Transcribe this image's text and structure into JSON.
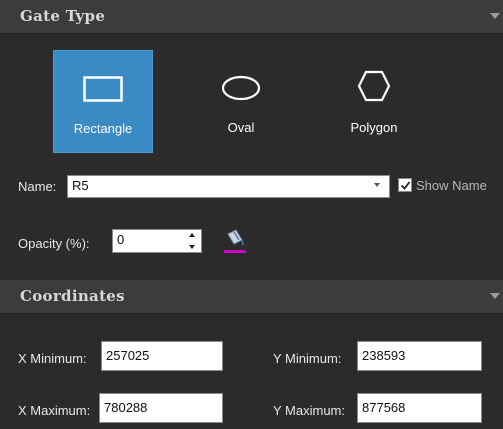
{
  "gate_type": {
    "title": "Gate Type",
    "options": [
      {
        "label": "Rectangle",
        "icon": "rectangle-icon",
        "selected": true
      },
      {
        "label": "Oval",
        "icon": "oval-icon",
        "selected": false
      },
      {
        "label": "Polygon",
        "icon": "hexagon-icon",
        "selected": false
      }
    ]
  },
  "name": {
    "label": "Name:",
    "value": "R5"
  },
  "show_name": {
    "label": "Show Name",
    "checked": true
  },
  "opacity": {
    "label": "Opacity (%):",
    "value": "0"
  },
  "coordinates": {
    "title": "Coordinates",
    "x_min_label": "X Minimum:",
    "x_min": "257025",
    "y_min_label": "Y Minimum:",
    "y_min": "238593",
    "x_max_label": "X Maximum:",
    "x_max": "780288",
    "y_max_label": "Y Maximum:",
    "y_max": "877568"
  },
  "colors": {
    "accent": "#3a8ac4",
    "panel_bg": "#2b2b2b",
    "header_bg": "#3c3c3c",
    "fill_indicator": "#cc00cc"
  }
}
